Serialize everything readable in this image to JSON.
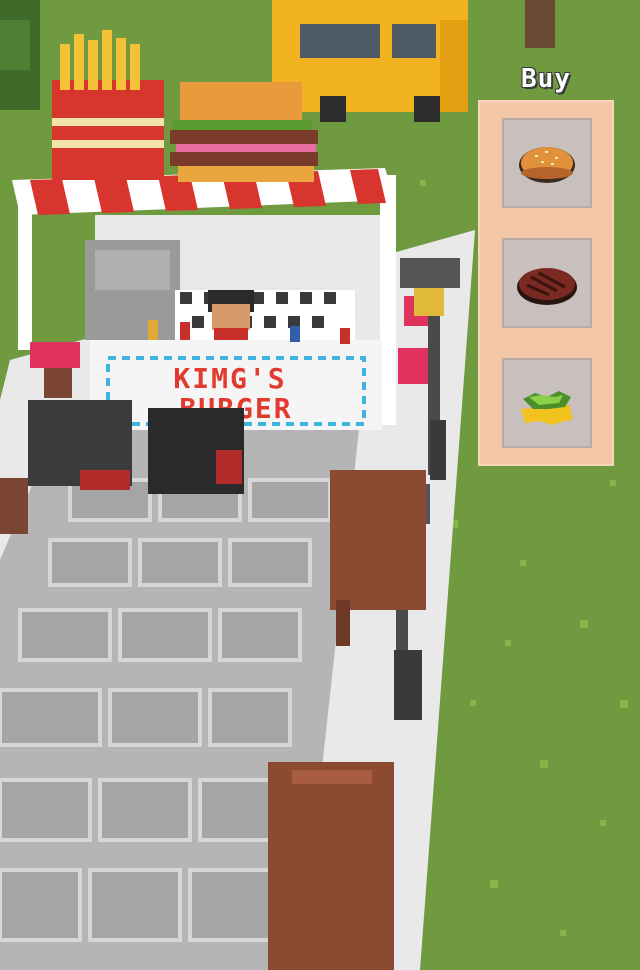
{
  "shop": {
    "title": "Buy",
    "items": [
      {
        "name": "bun",
        "icon": "burger-bun-icon"
      },
      {
        "name": "patty",
        "icon": "meat-patty-icon"
      },
      {
        "name": "cheese-lettuce",
        "icon": "cheese-lettuce-icon"
      }
    ]
  },
  "stand": {
    "sign_line1": "KIMG'S",
    "sign_line2": "BURGER"
  },
  "colors": {
    "grass": "#6f9a3f",
    "awning_red": "#d9352f",
    "panel": "#f3c6a5",
    "slot": "#c8c0bc",
    "sign_text": "#e23a2f",
    "truck": "#f2b320"
  }
}
